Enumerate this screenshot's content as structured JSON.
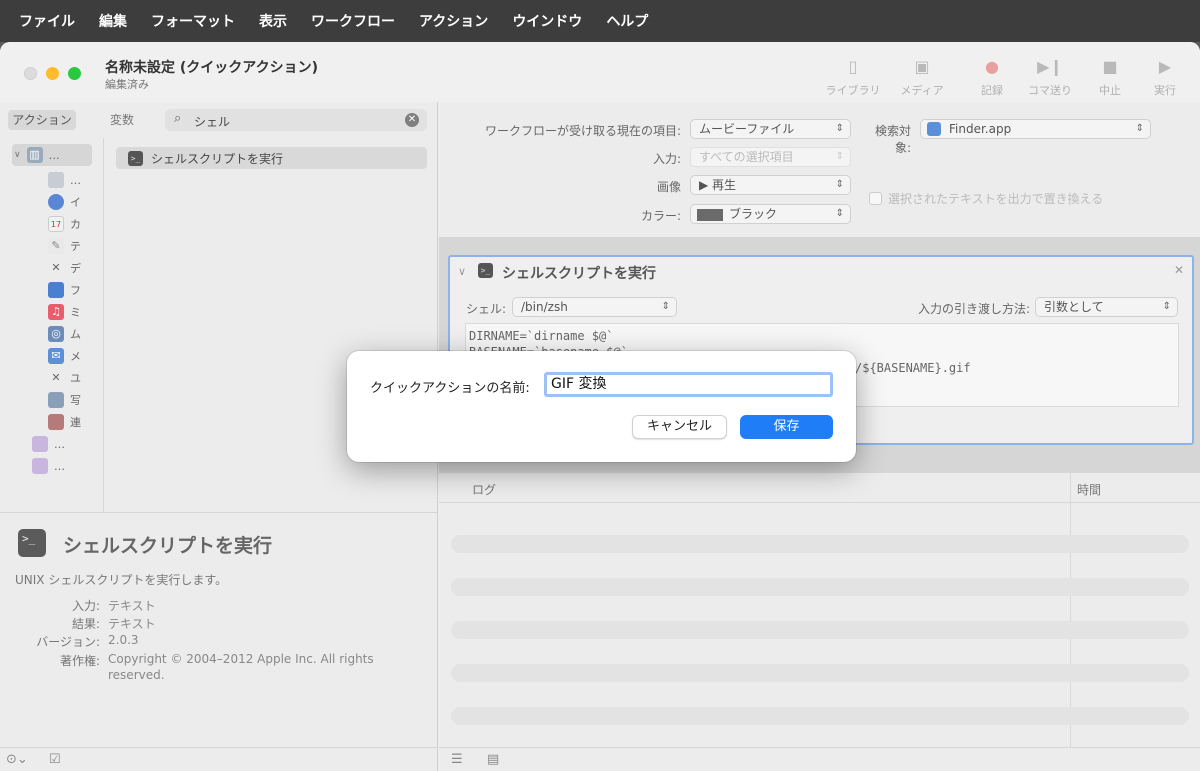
{
  "menubar": {
    "items": [
      "ファイル",
      "編集",
      "フォーマット",
      "表示",
      "ワークフロー",
      "アクション",
      "ウインドウ",
      "ヘルプ"
    ]
  },
  "window": {
    "title": "名称未設定 (クイックアクション)",
    "subtitle": "編集済み"
  },
  "toolbar": {
    "library": "ライブラリ",
    "media": "メディア",
    "record": "記録",
    "step": "コマ送り",
    "stop": "中止",
    "run": "実行"
  },
  "library": {
    "tab_actions": "アクション",
    "tab_variables": "変数",
    "search_value": "シェル",
    "tree_root": "…",
    "tree_items": [
      "…",
      "イ",
      "カ",
      "テ",
      "デ",
      "フ",
      "ミ",
      "ム",
      "メ",
      "ユ",
      "写",
      "連"
    ],
    "tree_folders": [
      "…",
      "…"
    ],
    "action_result": "シェルスクリプトを実行"
  },
  "description": {
    "title": "シェルスクリプトを実行",
    "text": "UNIX シェルスクリプトを実行します。",
    "input_key": "入力:",
    "input_val": "テキスト",
    "result_key": "結果:",
    "result_val": "テキスト",
    "version_key": "バージョン:",
    "version_val": "2.0.3",
    "copyright_key": "著作権:",
    "copyright_val_1": "Copyright © 2004–2012 Apple Inc.  All rights",
    "copyright_val_2": "reserved."
  },
  "workflow_settings": {
    "receives_label": "ワークフローが受け取る現在の項目:",
    "receives_value": "ムービーファイル",
    "search_label": "検索対象:",
    "search_value": "Finder.app",
    "input_label": "入力:",
    "input_value": "すべての選択項目",
    "replace_label": "選択されたテキストを出力で置き換える",
    "image_label": "画像",
    "image_value": "▶ 再生",
    "color_label": "カラー:",
    "color_value": "ブラック"
  },
  "action_card": {
    "title": "シェルスクリプトを実行",
    "shell_label": "シェル:",
    "shell_value": "/bin/zsh",
    "pass_label": "入力の引き渡し方法:",
    "pass_value": "引数として",
    "code_line_1": "DIRNAME=`dirname $@`",
    "code_line_2": "BASENAME=`basename $@`",
    "code_line_3": "/${BASENAME}.gif"
  },
  "log": {
    "col_log": "ログ",
    "col_time": "時間"
  },
  "dialog": {
    "label": "クイックアクションの名前:",
    "input_value": "GIF 変換",
    "cancel": "キャンセル",
    "save": "保存"
  },
  "colors": {
    "accent": "#1f7ef7",
    "close": "#dcdcdc",
    "minimize": "#fdbc2e",
    "maximize": "#2ac840"
  }
}
